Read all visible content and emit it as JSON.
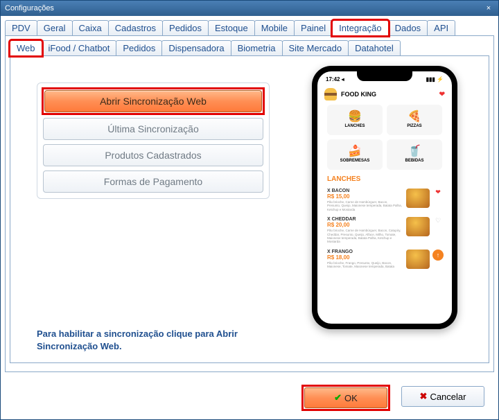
{
  "window": {
    "title": "Configurações",
    "close_icon": "×"
  },
  "tabs_outer": [
    {
      "label": "PDV"
    },
    {
      "label": "Geral"
    },
    {
      "label": "Caixa"
    },
    {
      "label": "Cadastros"
    },
    {
      "label": "Pedidos"
    },
    {
      "label": "Estoque"
    },
    {
      "label": "Mobile"
    },
    {
      "label": "Painel"
    },
    {
      "label": "Integração",
      "active": true,
      "highlight": true
    },
    {
      "label": "Dados"
    },
    {
      "label": "API"
    }
  ],
  "tabs_inner": [
    {
      "label": "Web",
      "active": true,
      "highlight": true
    },
    {
      "label": "iFood / Chatbot"
    },
    {
      "label": "Pedidos"
    },
    {
      "label": "Dispensadora"
    },
    {
      "label": "Biometria"
    },
    {
      "label": "Site Mercado"
    },
    {
      "label": "Datahotel"
    }
  ],
  "buttons": {
    "sync": "Abrir Sincronização Web",
    "last": "Última Sincronização",
    "products": "Produtos Cadastrados",
    "payments": "Formas de Pagamento"
  },
  "hint": "Para habilitar a sincronização clique para Abrir Sincronização Web.",
  "footer": {
    "ok": "OK",
    "cancel": "Cancelar"
  },
  "phone": {
    "time": "17:42 ◂",
    "signal": "▮▮▮ ⚡",
    "brand": "FOOD KING",
    "categories": [
      {
        "icon": "🍔",
        "label": "LANCHES"
      },
      {
        "icon": "🍕",
        "label": "PIZZAS"
      },
      {
        "icon": "🍰",
        "label": "SOBREMESAS"
      },
      {
        "icon": "🥤",
        "label": "BEBIDAS"
      }
    ],
    "section": "LANCHES",
    "items": [
      {
        "name": "X BACON",
        "price": "R$ 15,00",
        "desc": "Pão brioche, Carne de Hambúrguer, Bacon, Presunto, Queijo, Maionese temperada, Batata Palha, Ketchup e Mostarda",
        "side": "❤"
      },
      {
        "name": "X CHEDDAR",
        "price": "R$ 20,00",
        "desc": "Pão brioche, Carne de Hambúrguer, Bacon, Catupiry, Cheddar, Presunto, Queijo, Alface, Milho, Tomate, Maionese temperada, Batata Palha, Ketchup e Mostarda",
        "side": "♡"
      },
      {
        "name": "X FRANGO",
        "price": "R$ 18,00",
        "desc": "Pão brioche, Frango, Presunto, Queijo, Bacon, Maionese, Tomate, Maionese temperada, Batata",
        "side": "↑"
      }
    ]
  }
}
